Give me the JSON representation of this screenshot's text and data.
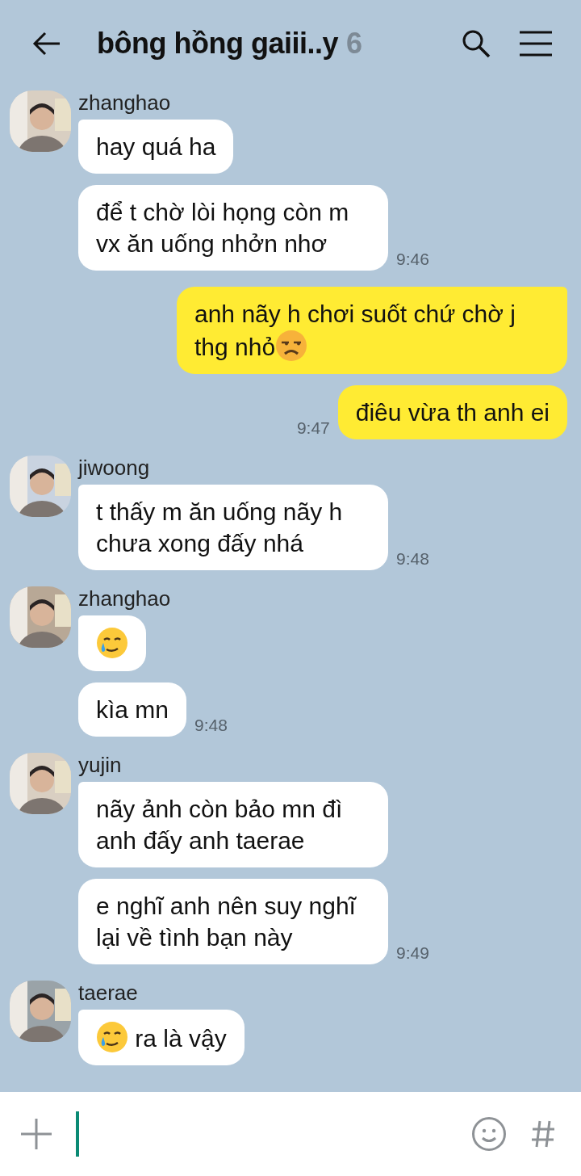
{
  "header": {
    "title": "bông hồng gaiii..y",
    "member_count": "6"
  },
  "groups": [
    {
      "kind": "received",
      "sender": "zhanghao",
      "bubbles": [
        {
          "parts": [
            {
              "kind": "text",
              "text": "hay quá ha"
            }
          ]
        },
        {
          "parts": [
            {
              "kind": "text",
              "text": "để t chờ lòi họng còn m vx ăn uống nhởn nhơ"
            }
          ],
          "time": "9:46"
        }
      ]
    },
    {
      "kind": "sent",
      "bubbles": [
        {
          "parts": [
            {
              "kind": "text",
              "text": "anh nãy h chơi suốt chứ chờ j thg nhỏ"
            },
            {
              "kind": "unamused"
            }
          ]
        },
        {
          "parts": [
            {
              "kind": "text",
              "text": "điêu vừa th anh ei"
            }
          ],
          "time": "9:47"
        }
      ]
    },
    {
      "kind": "received",
      "sender": "jiwoong",
      "bubbles": [
        {
          "parts": [
            {
              "kind": "text",
              "text": "t thấy m ăn uống nãy h chưa xong đấy nhá"
            }
          ],
          "time": "9:48"
        }
      ]
    },
    {
      "kind": "received",
      "sender": "zhanghao",
      "bubbles": [
        {
          "parts": [
            {
              "kind": "tear"
            }
          ]
        },
        {
          "parts": [
            {
              "kind": "text",
              "text": "kìa mn"
            }
          ],
          "time": "9:48"
        }
      ]
    },
    {
      "kind": "received",
      "sender": "yujin",
      "bubbles": [
        {
          "parts": [
            {
              "kind": "text",
              "text": "nãy ảnh còn bảo mn đì anh đấy anh taerae"
            }
          ]
        },
        {
          "parts": [
            {
              "kind": "text",
              "text": "e nghĩ anh nên suy nghĩ lại về tình bạn này"
            }
          ],
          "time": "9:49"
        }
      ]
    },
    {
      "kind": "received",
      "sender": "taerae",
      "bubbles": [
        {
          "parts": [
            {
              "kind": "tear"
            },
            {
              "kind": "text",
              "text": " ra là vậy"
            }
          ]
        }
      ]
    }
  ]
}
